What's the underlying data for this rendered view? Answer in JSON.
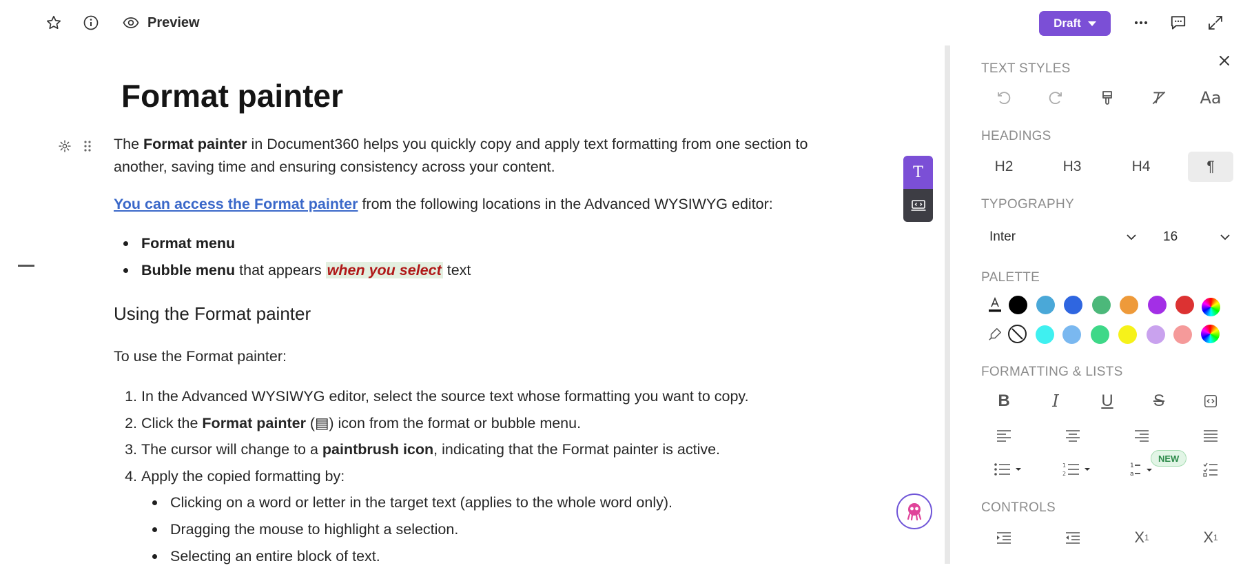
{
  "topbar": {
    "preview_label": "Preview",
    "draft_label": "Draft"
  },
  "document": {
    "title": "Format painter",
    "intro": {
      "t1": "The ",
      "b1": "Format painter",
      "t2": " in Document360 helps you quickly copy and apply text formatting from one section to",
      "t3": "another, saving time and ensuring consistency across your content."
    },
    "access": {
      "link": "You can access the Format painter",
      "rest": " from the following locations in the Advanced WYSIWYG editor:"
    },
    "bullets": [
      {
        "bold": "Format menu",
        "text": "",
        "hl": "",
        "tail": ""
      },
      {
        "bold": "Bubble menu",
        "text": " that appears ",
        "hl": "when you select",
        "tail": " text"
      }
    ],
    "heading": "Using the Format painter",
    "use_intro": "To use the Format painter:",
    "steps": [
      {
        "n": "1.",
        "a": "In the Advanced WYSIWYG editor, select the source text whose formatting you want to copy.",
        "b": "",
        "c": ""
      },
      {
        "n": "2.",
        "a": "Click the ",
        "b": "Format painter",
        "c": " (▤) icon from the format or bubble menu."
      },
      {
        "n": "3.",
        "a": "The cursor will change to a ",
        "b": "paintbrush icon",
        "c": ", indicating that the Format painter is active."
      },
      {
        "n": "4.",
        "a": "Apply the copied formatting by:",
        "b": "",
        "c": ""
      }
    ],
    "sub_steps": [
      "Clicking on a word or letter in the target text (applies to the whole word only).",
      "Dragging the mouse to highlight a selection.",
      "Selecting an entire block of text."
    ]
  },
  "panel": {
    "sections": {
      "text_styles": "TEXT STYLES",
      "headings": "HEADINGS",
      "typography": "TYPOGRAPHY",
      "palette": "PALETTE",
      "formatting": "FORMATTING & LISTS",
      "controls": "CONTROLS"
    },
    "headings": [
      "H2",
      "H3",
      "H4",
      "¶"
    ],
    "font": "Inter",
    "size": "16",
    "new_badge": "NEW",
    "text_colors": [
      "#000000",
      "#4aa8d8",
      "#2f66e0",
      "#4cb87a",
      "#ee9a3a",
      "#a32fe6",
      "#dc3232"
    ],
    "highlight_colors": [
      "#3ff0f0",
      "#7ab8f0",
      "#3ed888",
      "#f6f21a",
      "#c9a2ee",
      "#f59a9a"
    ],
    "accent": "#7b4fd6"
  }
}
